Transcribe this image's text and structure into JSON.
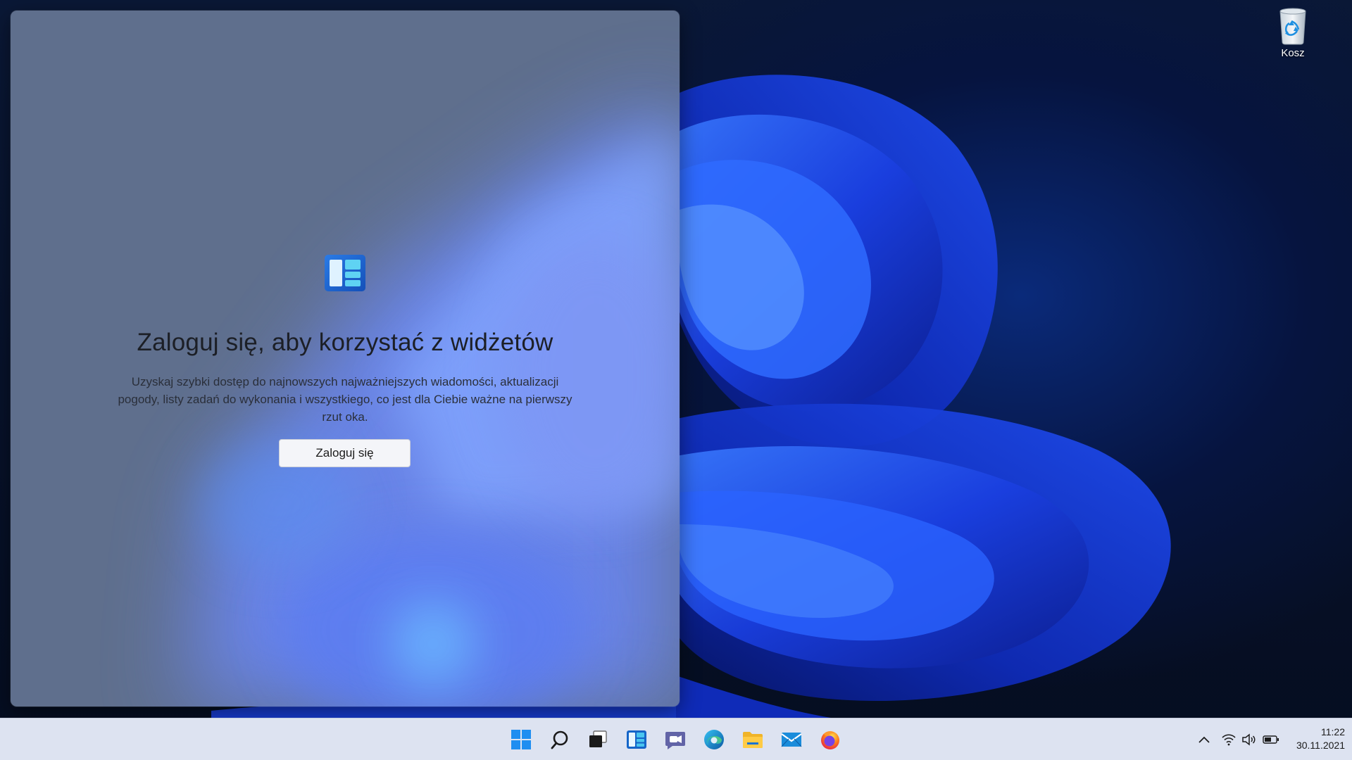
{
  "desktop": {
    "icons": [
      {
        "label": "Kosz",
        "icon": "recycle-bin-icon"
      }
    ]
  },
  "widgets_panel": {
    "logo_icon": "widgets-icon",
    "title": "Zaloguj się, aby korzystać z widżetów",
    "description": "Uzyskaj szybki dostęp do najnowszych najważniejszych wiadomości, aktualizacji pogody, listy zadań do wykonania i wszystkiego, co jest dla Ciebie ważne na pierwszy rzut oka.",
    "signin_label": "Zaloguj się"
  },
  "taskbar": {
    "pinned": [
      {
        "icon": "windows-start-icon"
      },
      {
        "icon": "search-icon"
      },
      {
        "icon": "task-view-icon"
      },
      {
        "icon": "widgets-icon"
      },
      {
        "icon": "teams-chat-icon"
      },
      {
        "icon": "edge-icon"
      },
      {
        "icon": "file-explorer-icon"
      },
      {
        "icon": "mail-icon"
      },
      {
        "icon": "firefox-icon"
      }
    ],
    "tray": {
      "icons": [
        "chevron-up-icon",
        "wifi-icon",
        "volume-icon",
        "battery-icon"
      ],
      "time": "11:22",
      "date": "30.11.2021"
    }
  },
  "colors": {
    "accent": "#0067c0",
    "taskbar_bg": "#dde3f1",
    "panel_bg": "#5f6f8d",
    "wallpaper_blue": "#1437e6"
  }
}
